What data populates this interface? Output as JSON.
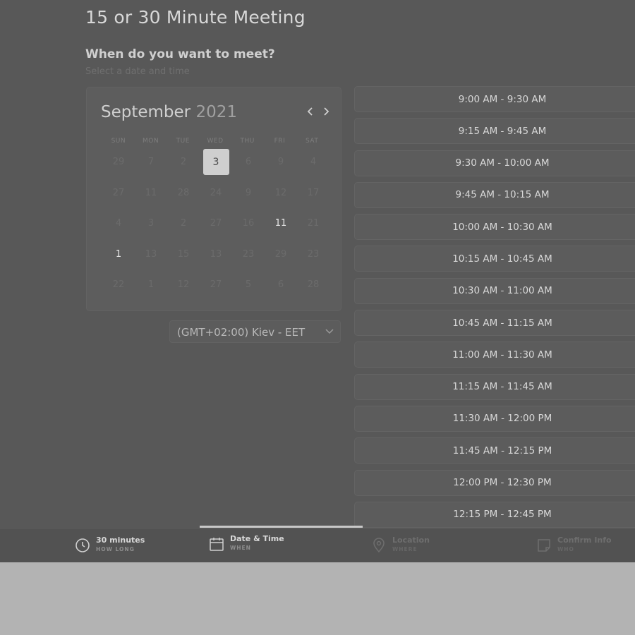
{
  "header": {
    "title": "15 or 30 Minute Meeting",
    "question": "When do you want to meet?",
    "hint": "Select a date and time"
  },
  "calendar": {
    "month": "September",
    "year": "2021",
    "prev_icon": "chevron-left-icon",
    "next_icon": "chevron-right-icon",
    "weekdays": [
      "SUN",
      "MON",
      "TUE",
      "WED",
      "THU",
      "FRI",
      "SAT"
    ],
    "weeks": [
      [
        "29",
        "7",
        "2",
        "3",
        "6",
        "9",
        "4"
      ],
      [
        "27",
        "11",
        "28",
        "24",
        "9",
        "12",
        "17"
      ],
      [
        "4",
        "3",
        "2",
        "27",
        "16",
        "11",
        "21"
      ],
      [
        "1",
        "13",
        "15",
        "13",
        "23",
        "29",
        "23"
      ],
      [
        "22",
        "1",
        "12",
        "27",
        "5",
        "6",
        "28"
      ]
    ],
    "selected_day": "3",
    "available_days": [
      "11",
      "1"
    ]
  },
  "timezone": {
    "label": "(GMT+02:00) Kiev - EET",
    "icon": "chevron-down-icon"
  },
  "slots": [
    "9:00 AM - 9:30 AM",
    "9:15 AM - 9:45 AM",
    "9:30 AM - 10:00 AM",
    "9:45 AM - 10:15 AM",
    "10:00 AM - 10:30 AM",
    "10:15 AM - 10:45 AM",
    "10:30 AM - 11:00 AM",
    "10:45 AM - 11:15 AM",
    "11:00 AM - 11:30 AM",
    "11:15 AM - 11:45 AM",
    "11:30 AM - 12:00 PM",
    "11:45 AM - 12:15 PM",
    "12:00 PM - 12:30 PM",
    "12:15 PM - 12:45 PM"
  ],
  "steps": [
    {
      "title": "30 minutes",
      "sub": "HOW LONG",
      "icon": "clock-icon",
      "active": true
    },
    {
      "title": "Date & Time",
      "sub": "WHEN",
      "icon": "calendar-icon",
      "active": true
    },
    {
      "title": "Location",
      "sub": "WHERE",
      "icon": "location-pin-icon",
      "active": false
    },
    {
      "title": "Confirm Info",
      "sub": "WHO",
      "icon": "note-icon",
      "active": false
    }
  ],
  "colors": {
    "overlay": "#585858",
    "backdrop": "#b3b3b3",
    "selected_day_bg": "#cfcfcf",
    "progress": "#c8c8c8"
  }
}
